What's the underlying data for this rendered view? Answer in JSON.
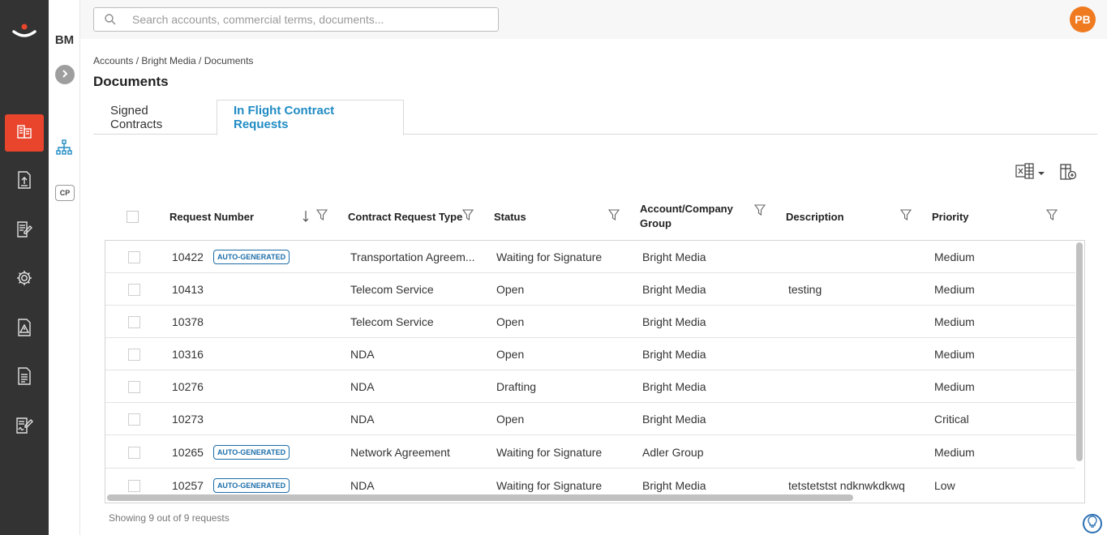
{
  "app": {
    "account_abbrev": "BM",
    "cp_label": "CP",
    "user_initials": "PB",
    "brand_color": "#e8452c",
    "accent_color": "#1f8bc4"
  },
  "search": {
    "placeholder": "Search accounts, commercial terms, documents..."
  },
  "breadcrumb": "Accounts / Bright Media / Documents",
  "page_title": "Documents",
  "tabs": [
    {
      "label": "Signed Contracts",
      "active": false
    },
    {
      "label": "In Flight Contract Requests",
      "active": true
    }
  ],
  "columns": {
    "request_number": "Request Number",
    "type": "Contract Request Type",
    "status": "Status",
    "account": "Account/Company Group",
    "description": "Description",
    "priority": "Priority"
  },
  "badge_label": "AUTO-GENERATED",
  "rows": [
    {
      "number": "10422",
      "auto": true,
      "type": "Transportation Agreem...",
      "status": "Waiting for Signature",
      "account": "Bright Media",
      "description": "",
      "priority": "Medium"
    },
    {
      "number": "10413",
      "auto": false,
      "type": "Telecom Service",
      "status": "Open",
      "account": "Bright Media",
      "description": "testing",
      "priority": "Medium"
    },
    {
      "number": "10378",
      "auto": false,
      "type": "Telecom Service",
      "status": "Open",
      "account": "Bright Media",
      "description": "",
      "priority": "Medium"
    },
    {
      "number": "10316",
      "auto": false,
      "type": "NDA",
      "status": "Open",
      "account": "Bright Media",
      "description": "",
      "priority": "Medium"
    },
    {
      "number": "10276",
      "auto": false,
      "type": "NDA",
      "status": "Drafting",
      "account": "Bright Media",
      "description": "",
      "priority": "Medium"
    },
    {
      "number": "10273",
      "auto": false,
      "type": "NDA",
      "status": "Open",
      "account": "Bright Media",
      "description": "",
      "priority": "Critical"
    },
    {
      "number": "10265",
      "auto": true,
      "type": "Network Agreement",
      "status": "Waiting for Signature",
      "account": "Adler Group",
      "description": "",
      "priority": "Medium"
    },
    {
      "number": "10257",
      "auto": true,
      "type": "NDA",
      "status": "Waiting for Signature",
      "account": "Bright Media",
      "description": "tetstetstst ndknwkdkwq",
      "priority": "Low"
    }
  ],
  "footer": "Showing 9 out of 9 requests",
  "icons": {
    "rail": [
      "accounts-icon",
      "upload-document-icon",
      "edit-document-icon",
      "settings-gear-icon",
      "alert-document-icon",
      "report-document-icon",
      "signature-icon"
    ]
  }
}
